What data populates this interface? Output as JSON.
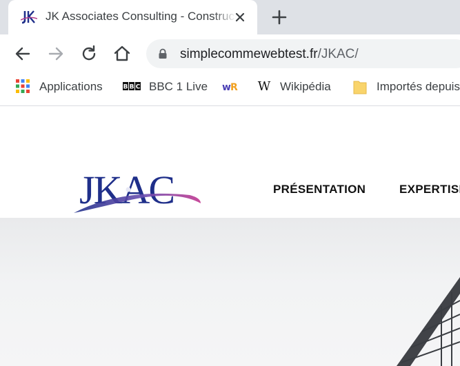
{
  "tab": {
    "title": "JK Associates Consulting - Construction",
    "favicon_icon": "jk-logo-icon"
  },
  "toolbar": {
    "url_host": "simplecommewebtest.fr",
    "url_path": "/JKAC/"
  },
  "bookmarks": [
    {
      "label": "Applications",
      "icon": "apps-grid-icon"
    },
    {
      "label": "BBC 1 Live",
      "icon": "bbc-icon"
    },
    {
      "label": "",
      "icon": "wr-icon"
    },
    {
      "label": "Wikipédia",
      "icon": "wikipedia-icon"
    },
    {
      "label": "Importés depuis",
      "icon": "folder-icon"
    }
  ],
  "site": {
    "logo_text": "JKAC",
    "nav": [
      "PRÉSENTATION",
      "EXPERTISE"
    ]
  },
  "colors": {
    "tabstrip": "#dee1e6",
    "omnibox": "#f1f3f4",
    "logo_blue": "#1f2f8a",
    "logo_pink": "#b23a8a"
  }
}
